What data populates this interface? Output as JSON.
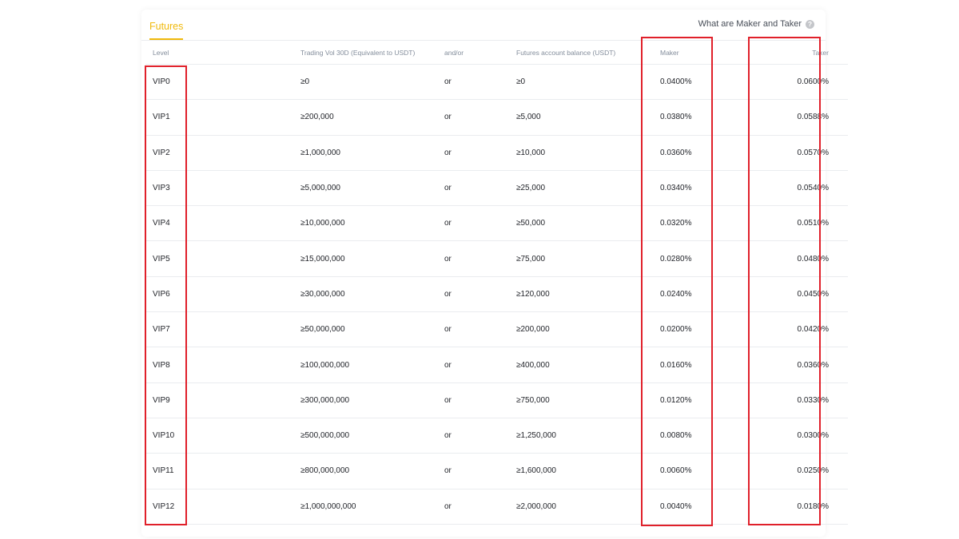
{
  "tabs": [
    {
      "label": "Futures",
      "active": true
    }
  ],
  "help_link": {
    "label": "What are Maker and Taker",
    "icon": "question-circle-icon"
  },
  "table": {
    "headers": {
      "level": "Level",
      "volume": "Trading Vol 30D (Equivalent to USDT)",
      "andor": "and/or",
      "balance": "Futures account balance (USDT)",
      "maker": "Maker",
      "taker": "Taker"
    },
    "rows": [
      {
        "level": "VIP0",
        "volume": "≥0",
        "andor": "or",
        "balance": "≥0",
        "maker": "0.0400%",
        "taker": "0.0600%"
      },
      {
        "level": "VIP1",
        "volume": "≥200,000",
        "andor": "or",
        "balance": "≥5,000",
        "maker": "0.0380%",
        "taker": "0.0588%"
      },
      {
        "level": "VIP2",
        "volume": "≥1,000,000",
        "andor": "or",
        "balance": "≥10,000",
        "maker": "0.0360%",
        "taker": "0.0570%"
      },
      {
        "level": "VIP3",
        "volume": "≥5,000,000",
        "andor": "or",
        "balance": "≥25,000",
        "maker": "0.0340%",
        "taker": "0.0540%"
      },
      {
        "level": "VIP4",
        "volume": "≥10,000,000",
        "andor": "or",
        "balance": "≥50,000",
        "maker": "0.0320%",
        "taker": "0.0510%"
      },
      {
        "level": "VIP5",
        "volume": "≥15,000,000",
        "andor": "or",
        "balance": "≥75,000",
        "maker": "0.0280%",
        "taker": "0.0480%"
      },
      {
        "level": "VIP6",
        "volume": "≥30,000,000",
        "andor": "or",
        "balance": "≥120,000",
        "maker": "0.0240%",
        "taker": "0.0450%"
      },
      {
        "level": "VIP7",
        "volume": "≥50,000,000",
        "andor": "or",
        "balance": "≥200,000",
        "maker": "0.0200%",
        "taker": "0.0420%"
      },
      {
        "level": "VIP8",
        "volume": "≥100,000,000",
        "andor": "or",
        "balance": "≥400,000",
        "maker": "0.0160%",
        "taker": "0.0360%"
      },
      {
        "level": "VIP9",
        "volume": "≥300,000,000",
        "andor": "or",
        "balance": "≥750,000",
        "maker": "0.0120%",
        "taker": "0.0330%"
      },
      {
        "level": "VIP10",
        "volume": "≥500,000,000",
        "andor": "or",
        "balance": "≥1,250,000",
        "maker": "0.0080%",
        "taker": "0.0300%"
      },
      {
        "level": "VIP11",
        "volume": "≥800,000,000",
        "andor": "or",
        "balance": "≥1,600,000",
        "maker": "0.0060%",
        "taker": "0.0250%"
      },
      {
        "level": "VIP12",
        "volume": "≥1,000,000,000",
        "andor": "or",
        "balance": "≥2,000,000",
        "maker": "0.0040%",
        "taker": "0.0180%"
      }
    ]
  },
  "colors": {
    "accent": "#f0b90b",
    "highlight": "#e0202a",
    "text": "#1e2026",
    "muted": "#848e9c"
  }
}
